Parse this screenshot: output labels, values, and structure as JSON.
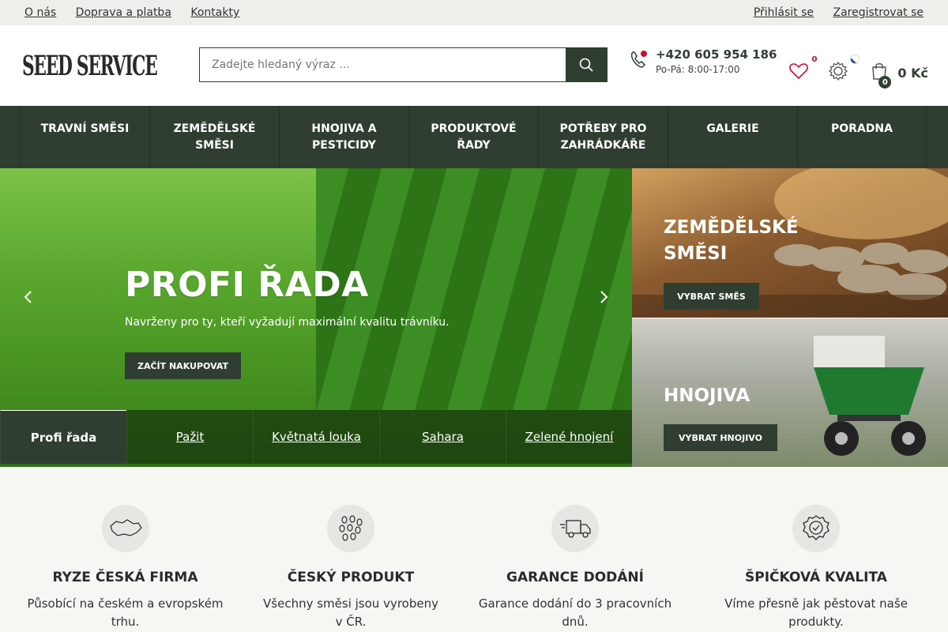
{
  "topbar": {
    "left_links": [
      "O nás",
      "Doprava a platba",
      "Kontakty"
    ],
    "login": "Přihlásit se",
    "register": "Zaregistrovat se"
  },
  "header": {
    "logo_text": "SEED SERVICE",
    "search_placeholder": "Zadejte hledaný výraz ...",
    "phone": "+420 605 954 186",
    "hours": "Po-Pá: 8:00-17:00",
    "wishlist_count": "0",
    "cart_count": "0",
    "cart_price": "0 Kč"
  },
  "nav": [
    {
      "line1": "Travní směsi",
      "line2": ""
    },
    {
      "line1": "Zemědělské",
      "line2": "směsi"
    },
    {
      "line1": "Hnojiva a",
      "line2": "pesticidy"
    },
    {
      "line1": "Produktové",
      "line2": "řady"
    },
    {
      "line1": "Potřeby pro",
      "line2": "zahrádkáře"
    },
    {
      "line1": "Galerie",
      "line2": ""
    },
    {
      "line1": "Poradna",
      "line2": ""
    }
  ],
  "hero": {
    "title": "PROFI ŘADA",
    "subtitle": "Navrženy pro ty, kteří vyžadují maximální kvalitu trávníku.",
    "button": "ZAČÍT NAKUPOVAT",
    "tabs": [
      "Profi řada",
      "Pažit",
      "Květnatá louka",
      "Sahara",
      "Zelené hnojení"
    ]
  },
  "side": {
    "card1": {
      "title_line1": "ZEMĚDĚLSKÉ",
      "title_line2": "SMĚSI",
      "button": "VYBRAT SMĚS"
    },
    "card2": {
      "title": "HNOJIVA",
      "button": "VYBRAT HNOJIVO"
    }
  },
  "features": [
    {
      "icon": "czech-map-icon",
      "title": "RYZE ČESKÁ FIRMA",
      "line1": "Působící na českém a evropském",
      "line2": "trhu."
    },
    {
      "icon": "seeds-icon",
      "title": "ČESKÝ PRODUKT",
      "line1": "Všechny směsi jsou vyrobeny",
      "line2": "v ČR."
    },
    {
      "icon": "delivery-truck-icon",
      "title": "GARANCE DODÁNÍ",
      "line1": "Garance dodání do 3 pracovních",
      "line2": "dnů."
    },
    {
      "icon": "quality-badge-icon",
      "title": "ŠPIČKOVÁ KVALITA",
      "line1": "Víme přesně jak pěstovat naše",
      "line2": "produkty."
    }
  ],
  "colors": {
    "primary": "#2f3e31",
    "accent_red": "#c8102e",
    "topbar": "#eeeeea"
  }
}
